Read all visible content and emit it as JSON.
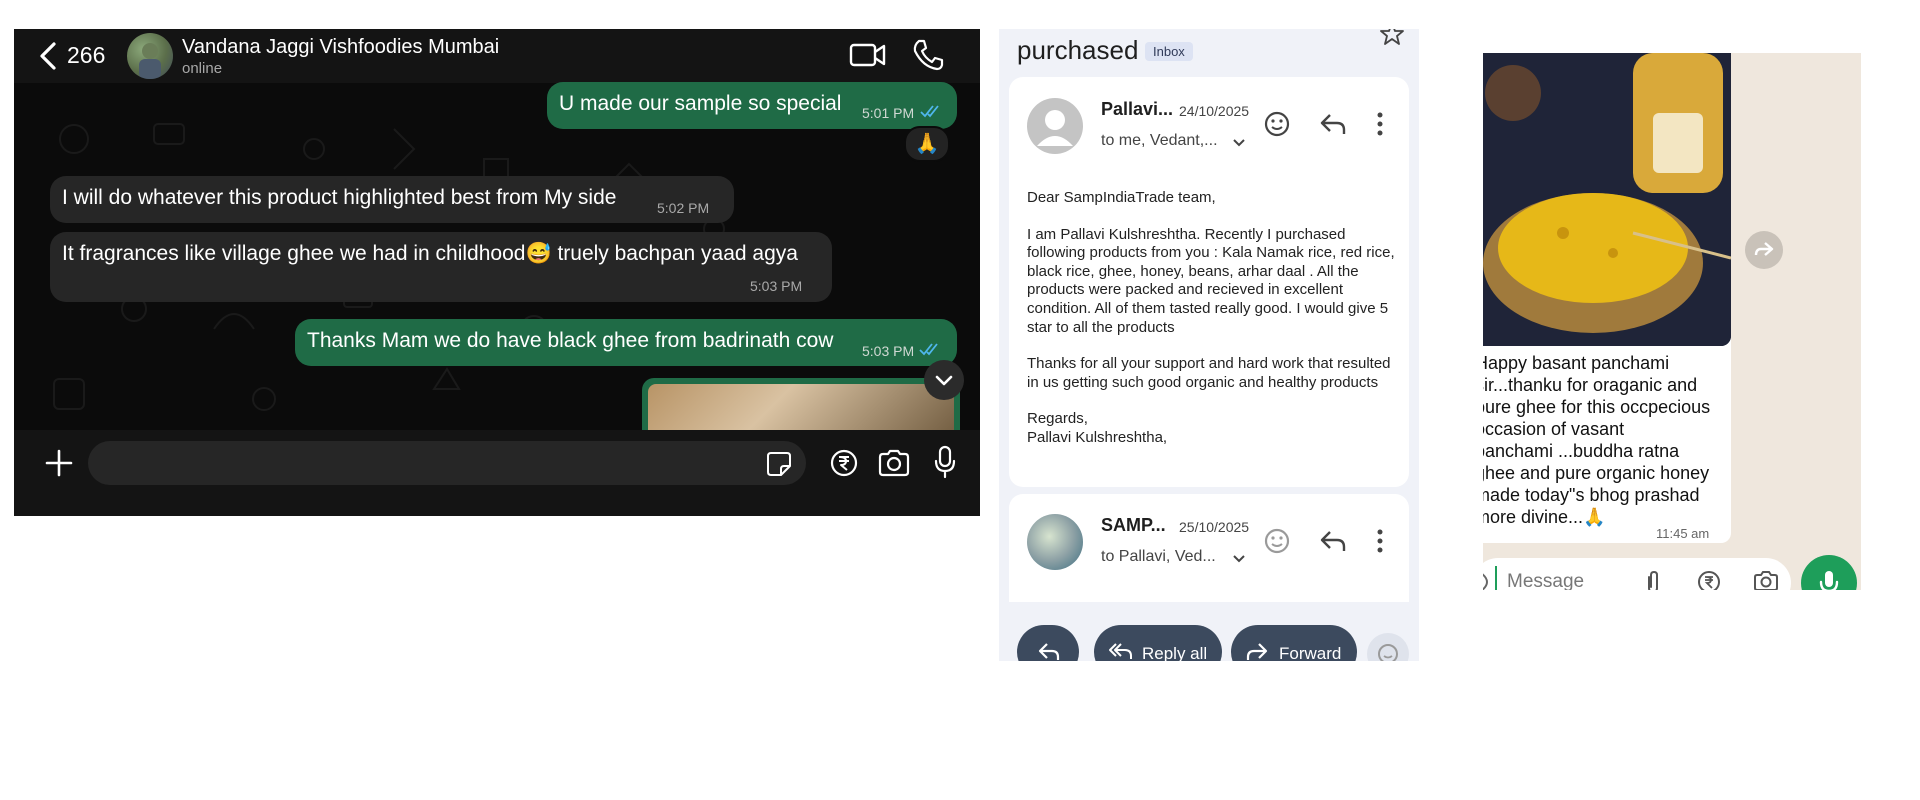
{
  "whatsapp_dark": {
    "back_count": "266",
    "contact_name": "Vandana Jaggi Vishfoodies Mumbai",
    "status": "online",
    "messages": [
      {
        "text": "U made our sample so special",
        "time": "5:01 PM"
      },
      {
        "text": "I will do whatever this product  highlighted best from My side",
        "time": "5:02 PM"
      },
      {
        "text": "It fragrances like village ghee we had in childhood😅 truely bachpan yaad agya",
        "time": "5:03 PM"
      },
      {
        "text": "Thanks Mam we do have black ghee from badrinath cow",
        "time": "5:03 PM"
      }
    ],
    "reaction": "🙏"
  },
  "gmail": {
    "subject_fragment": "purchased",
    "label": "Inbox",
    "email1": {
      "sender": "Pallavi...",
      "date": "24/10/2025",
      "to": "to me, Vedant,...",
      "body": [
        "Dear SampIndiaTrade team,",
        "I am Pallavi Kulshreshtha. Recently I purchased following products from you : Kala Namak rice, red rice, black rice, ghee, honey, beans, arhar daal . All the products were packed and recieved in excellent condition. All of them tasted really good. I would give 5 star to all the products",
        "Thanks for all your support and hard work that resulted in us getting such good organic and healthy products",
        "Regards,\nPallavi Kulshreshtha,"
      ]
    },
    "email2": {
      "sender": "SAMP...",
      "date": "25/10/2025",
      "to": "to Pallavi, Ved..."
    },
    "actions": {
      "reply_all": "Reply all",
      "forward": "Forward"
    }
  },
  "whatsapp_light": {
    "caption": "Happy basant panchami\nsir...thanku for oraganic and\npure ghee for this occpecious\noccasion of vasant\npanchami ...buddha ratna\nghee and pure organic honey\nmade today\"s bhog prashad\nmore divine...🙏",
    "time": "11:45 am",
    "input_placeholder": "Message"
  },
  "colors": {
    "wa_dark_out": "#1f6b46",
    "wa_dark_in": "#262626",
    "gmail_button": "#3c4a5e",
    "wa_green": "#1e9e5a"
  }
}
